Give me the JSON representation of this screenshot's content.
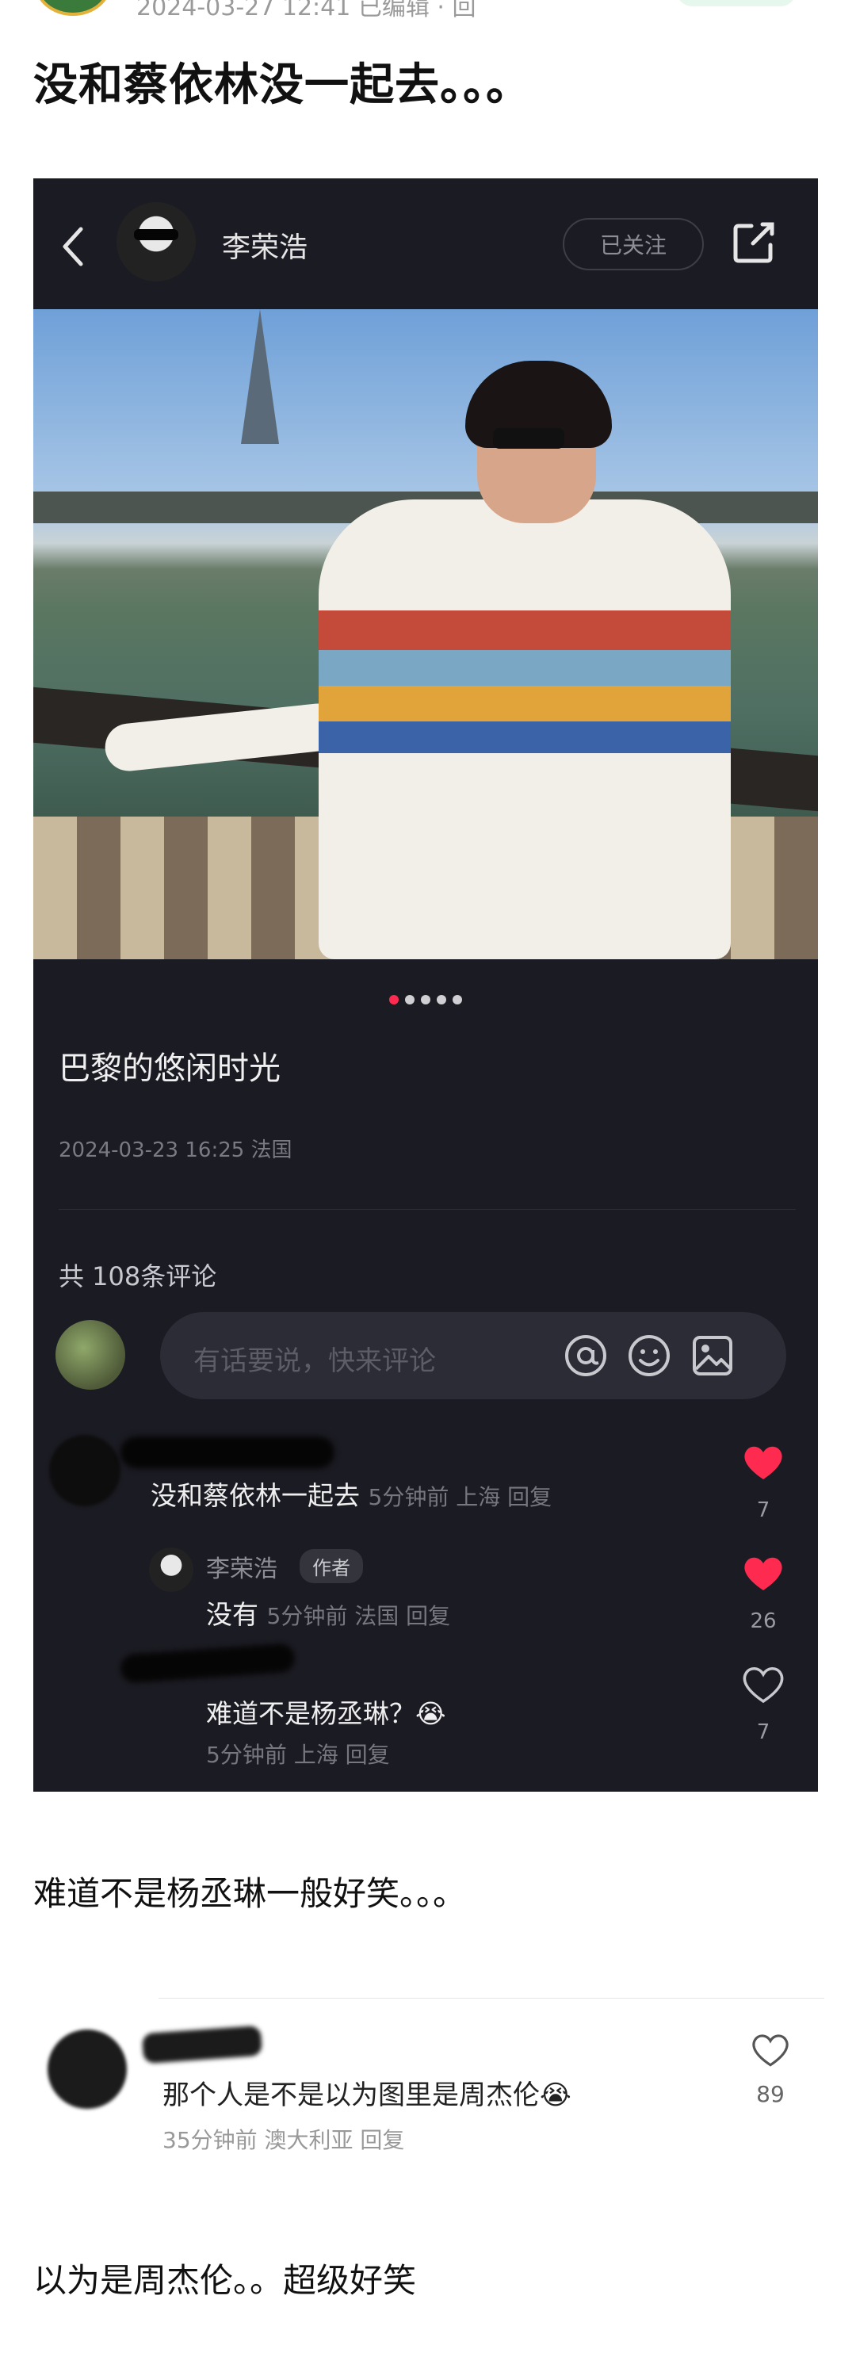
{
  "top_meta": {
    "text": "2024-03-27 12:41 已编辑 · 回"
  },
  "post": {
    "title": "没和蔡依林没一起去。。。"
  },
  "card": {
    "author_name": "李荣浩",
    "follow_label": "已关注",
    "caption": "巴黎的悠闲时光",
    "meta": "2024-03-23 16:25 法国",
    "comment_count": "共 108条评论",
    "comment_placeholder": "有话要说，快来评论",
    "carousel": {
      "total": 5,
      "active": 1
    },
    "comments": [
      {
        "text": "没和蔡依林一起去",
        "meta": "5分钟前  上海  回复",
        "likes": "7",
        "liked": true
      },
      {
        "name": "李荣浩",
        "tag": "作者",
        "text": "没有",
        "meta": "5分钟前  法国  回复",
        "likes": "26",
        "liked": true
      },
      {
        "text": "难道不是杨丞琳？😭",
        "meta": "5分钟前  上海  回复",
        "likes": "7",
        "liked": false
      }
    ]
  },
  "paragraph1": "难道不是杨丞琳一般好笑。。。",
  "reply": {
    "text": "那个人是不是以为图里是周杰伦😭",
    "meta": "35分钟前  澳大利亚  回复",
    "likes": "89"
  },
  "paragraph2": "以为是周杰伦。。超级好笑",
  "colors": {
    "like_red": "#ff2a50",
    "card_bg": "#1b1b23"
  }
}
